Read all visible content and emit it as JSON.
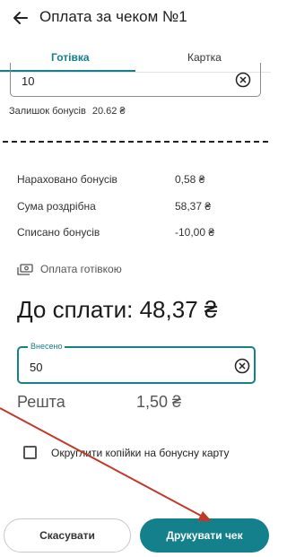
{
  "header": {
    "title": "Оплата за чеком №1",
    "back_icon": "arrow-left-icon"
  },
  "tabs": [
    {
      "label": "Готівка",
      "active": true
    },
    {
      "label": "Картка",
      "active": false
    }
  ],
  "bonus_field": {
    "value": "10"
  },
  "bonus_remaining": {
    "label": "Залишок бонусів",
    "value": "20.62 ₴"
  },
  "summary": [
    {
      "label": "Нараховано бонусів",
      "value": "0,58 ₴"
    },
    {
      "label": "Сума роздрібна",
      "value": "58,37 ₴"
    },
    {
      "label": "Списано бонусів",
      "value": "-10,00 ₴"
    }
  ],
  "payment_method": "Оплата готівкою",
  "to_pay": "До сплати: 48,37 ₴",
  "paid_field": {
    "label": "Внесено",
    "value": "50"
  },
  "change": {
    "label": "Решта",
    "value": "1,50 ₴"
  },
  "round_checkbox": {
    "label": "Округлити копійки на бонусну карту",
    "checked": false
  },
  "buttons": {
    "cancel": "Скасувати",
    "print": "Друкувати чек"
  },
  "colors": {
    "accent": "#13808b",
    "annotation_arrow": "#c0392b"
  }
}
